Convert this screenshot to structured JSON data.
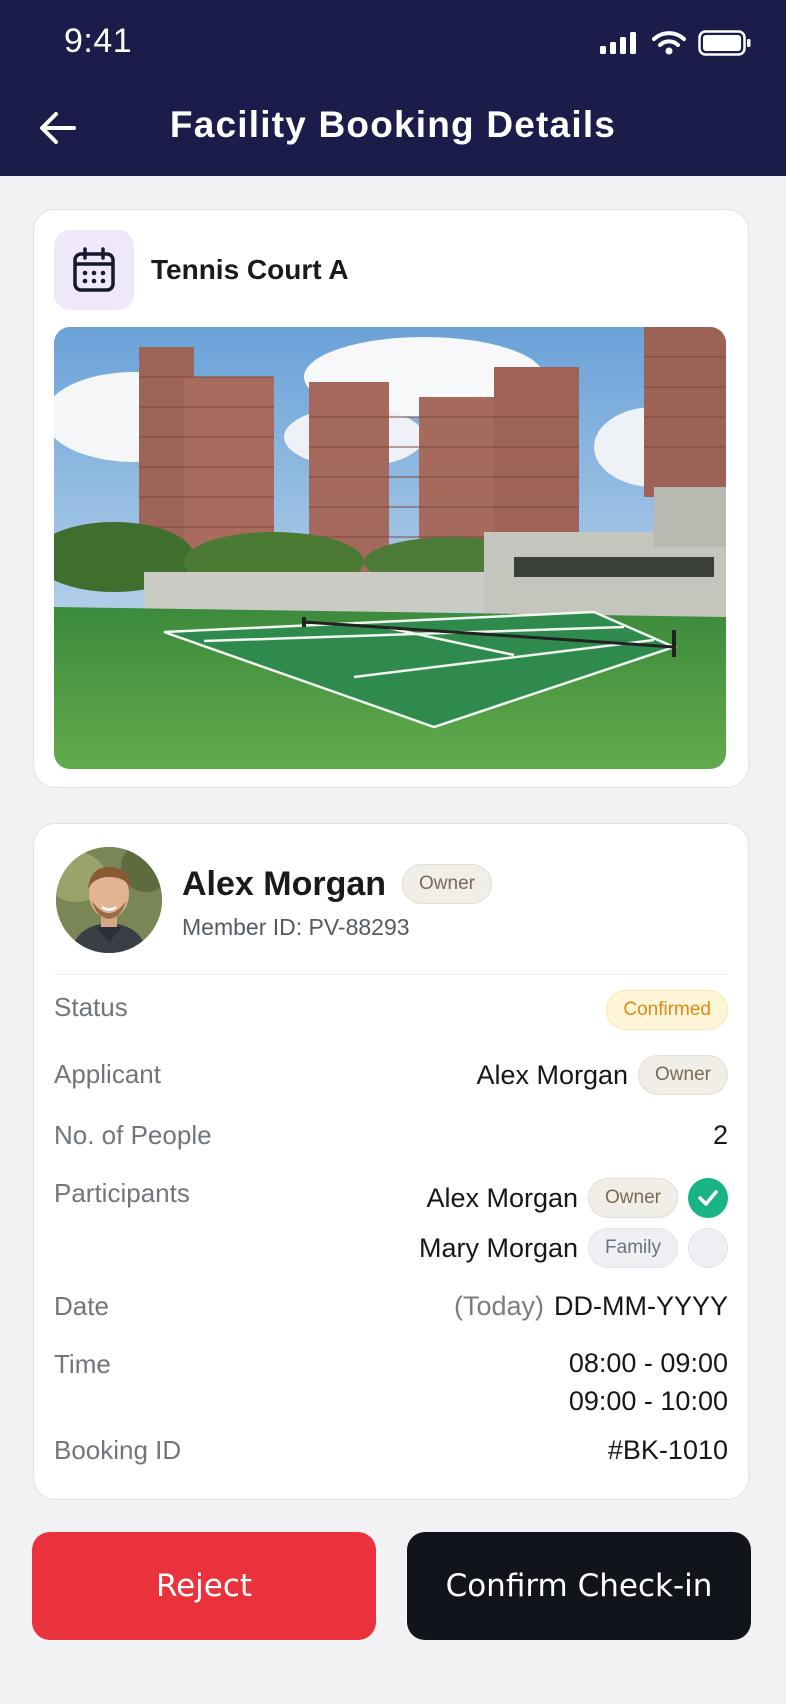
{
  "status_bar": {
    "time": "9:41"
  },
  "header": {
    "title": "Facility Booking Details"
  },
  "facility": {
    "name": "Tennis Court A"
  },
  "member": {
    "name": "Alex Morgan",
    "role": "Owner",
    "member_id": "Member ID: PV-88293"
  },
  "details": {
    "status": {
      "label": "Status",
      "value": "Confirmed"
    },
    "applicant": {
      "label": "Applicant",
      "name": "Alex Morgan",
      "role": "Owner"
    },
    "people": {
      "label": "No. of People",
      "value": "2"
    },
    "participants": {
      "label": "Participants",
      "items": [
        {
          "name": "Alex Morgan",
          "role": "Owner",
          "checked": true
        },
        {
          "name": "Mary Morgan",
          "role": "Family",
          "checked": false
        }
      ]
    },
    "date": {
      "label": "Date",
      "prefix": "(Today)",
      "value": "DD-MM-YYYY"
    },
    "time": {
      "label": "Time",
      "slots": [
        "08:00 - 09:00",
        "09:00 - 10:00"
      ]
    },
    "booking_id": {
      "label": "Booking ID",
      "value": "#BK-1010"
    }
  },
  "actions": {
    "reject_label": "Reject",
    "confirm_label": "Confirm Check-in"
  },
  "colors": {
    "header_bg": "#1b1c4a",
    "reject": "#ea323c",
    "confirm": "#12141c",
    "check": "#19b386",
    "confirmed_text": "#de8a14"
  },
  "icons": {
    "back": "arrow-left-icon",
    "facility": "calendar-icon",
    "check": "check-icon"
  }
}
